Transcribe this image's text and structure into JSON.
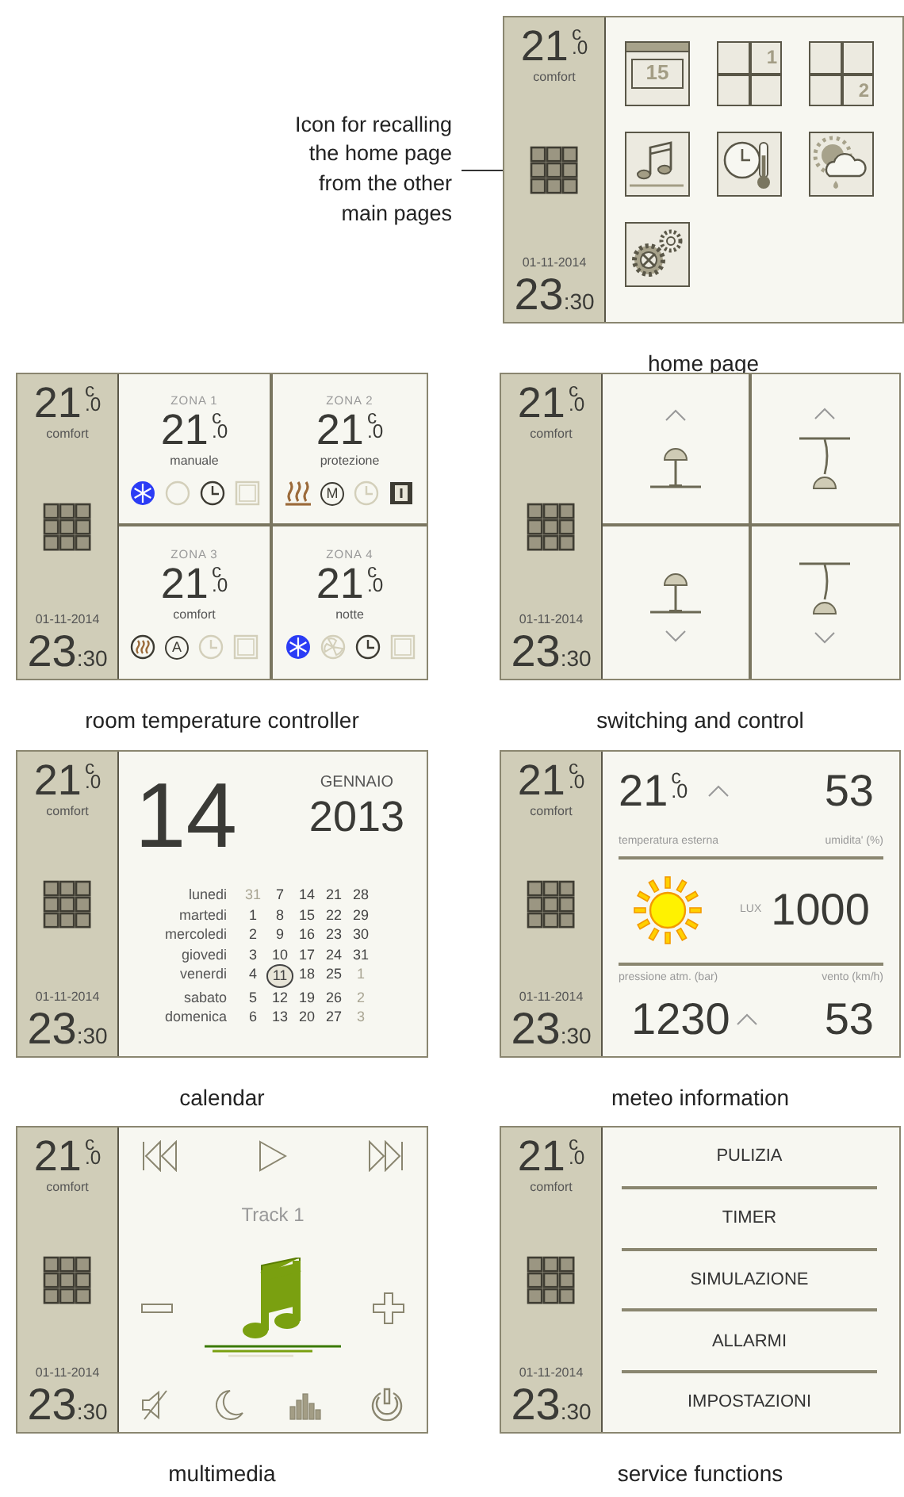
{
  "annotation": {
    "text": "Icon for recalling\nthe home page\nfrom the other\nmain pages"
  },
  "screens": [
    {
      "kind": "home",
      "caption": "home page",
      "sidebar": {
        "temp": "21",
        "decimal": ".0",
        "unit": "c",
        "mode": "comfort",
        "date": "01-11-2014",
        "hour": "23",
        "minutes": ":30"
      },
      "tiles": [
        {
          "kind": "calendar",
          "label": "15"
        },
        {
          "kind": "zones",
          "label": "1",
          "label_at_bottom": false
        },
        {
          "kind": "zones",
          "label": "2",
          "label_at_bottom": true
        },
        {
          "kind": "music"
        },
        {
          "kind": "climate"
        },
        {
          "kind": "weather"
        },
        {
          "kind": "settings"
        }
      ]
    },
    {
      "kind": "thermostat",
      "caption": "room temperature controller",
      "sidebar": {
        "temp": "21",
        "decimal": ".0",
        "unit": "c",
        "mode": "comfort",
        "date": "01-11-2014",
        "hour": "23",
        "minutes": ":30"
      },
      "zones": [
        {
          "title": "ZONA 1",
          "temp": "21",
          "decimal": ".0",
          "unit": "c",
          "mode": "manuale",
          "icons": [
            {
              "kind": "snowflake",
              "active": true
            },
            {
              "kind": "circle",
              "active": false
            },
            {
              "kind": "clock",
              "active": true
            },
            {
              "kind": "window",
              "active": false
            }
          ]
        },
        {
          "title": "ZONA 2",
          "temp": "21",
          "decimal": ".0",
          "unit": "c",
          "mode": "protezione",
          "icons": [
            {
              "kind": "heater",
              "active": true
            },
            {
              "kind": "letter",
              "label": "M",
              "active": true
            },
            {
              "kind": "clock",
              "active": false
            },
            {
              "kind": "window-alert",
              "active": true
            }
          ]
        },
        {
          "title": "ZONA 3",
          "temp": "21",
          "decimal": ".0",
          "unit": "c",
          "mode": "comfort",
          "icons": [
            {
              "kind": "heater-circle",
              "active": true
            },
            {
              "kind": "letter",
              "label": "A",
              "active": true
            },
            {
              "kind": "clock",
              "active": false
            },
            {
              "kind": "window",
              "active": false
            }
          ]
        },
        {
          "title": "ZONA 4",
          "temp": "21",
          "decimal": ".0",
          "unit": "c",
          "mode": "notte",
          "icons": [
            {
              "kind": "snowflake",
              "active": true
            },
            {
              "kind": "fan",
              "active": false
            },
            {
              "kind": "clock",
              "active": true
            },
            {
              "kind": "window",
              "active": false
            }
          ]
        }
      ]
    },
    {
      "kind": "switching",
      "caption": "switching and control",
      "sidebar": {
        "temp": "21",
        "decimal": ".0",
        "unit": "c",
        "mode": "comfort",
        "date": "01-11-2014",
        "hour": "23",
        "minutes": ":30"
      },
      "lights": [
        {
          "kind": "table-lamp",
          "arrow_up": true
        },
        {
          "kind": "pendant-lamp",
          "arrow_up": true
        },
        {
          "kind": "table-lamp",
          "arrow_up": false
        },
        {
          "kind": "pendant-lamp",
          "arrow_up": false
        }
      ]
    },
    {
      "kind": "calendar",
      "caption": "calendar",
      "sidebar": {
        "temp": "21",
        "decimal": ".0",
        "unit": "c",
        "mode": "comfort",
        "date": "01-11-2014",
        "hour": "23",
        "minutes": ":30"
      },
      "day": "14",
      "month": "GENNAIO",
      "year": "2013",
      "weeks": [
        {
          "name": "lunedi",
          "days": [
            {
              "text": "31",
              "muted": true,
              "selected": false
            },
            {
              "text": "7",
              "muted": false,
              "selected": false
            },
            {
              "text": "14",
              "muted": false,
              "selected": false
            },
            {
              "text": "21",
              "muted": false,
              "selected": false
            },
            {
              "text": "28",
              "muted": false,
              "selected": false
            }
          ]
        },
        {
          "name": "martedi",
          "days": [
            {
              "text": "1",
              "muted": false,
              "selected": false
            },
            {
              "text": "8",
              "muted": false,
              "selected": false
            },
            {
              "text": "15",
              "muted": false,
              "selected": false
            },
            {
              "text": "22",
              "muted": false,
              "selected": false
            },
            {
              "text": "29",
              "muted": false,
              "selected": false
            }
          ]
        },
        {
          "name": "mercoledi",
          "days": [
            {
              "text": "2",
              "muted": false,
              "selected": false
            },
            {
              "text": "9",
              "muted": false,
              "selected": false
            },
            {
              "text": "16",
              "muted": false,
              "selected": false
            },
            {
              "text": "23",
              "muted": false,
              "selected": false
            },
            {
              "text": "30",
              "muted": false,
              "selected": false
            }
          ]
        },
        {
          "name": "giovedi",
          "days": [
            {
              "text": "3",
              "muted": false,
              "selected": false
            },
            {
              "text": "10",
              "muted": false,
              "selected": false
            },
            {
              "text": "17",
              "muted": false,
              "selected": false
            },
            {
              "text": "24",
              "muted": false,
              "selected": false
            },
            {
              "text": "31",
              "muted": false,
              "selected": false
            }
          ]
        },
        {
          "name": "venerdi",
          "days": [
            {
              "text": "4",
              "muted": false,
              "selected": false
            },
            {
              "text": "11",
              "muted": false,
              "selected": true
            },
            {
              "text": "18",
              "muted": false,
              "selected": false
            },
            {
              "text": "25",
              "muted": false,
              "selected": false
            },
            {
              "text": "1",
              "muted": true,
              "selected": false
            }
          ]
        },
        {
          "name": "sabato",
          "days": [
            {
              "text": "5",
              "muted": false,
              "selected": false
            },
            {
              "text": "12",
              "muted": false,
              "selected": false
            },
            {
              "text": "19",
              "muted": false,
              "selected": false
            },
            {
              "text": "26",
              "muted": false,
              "selected": false
            },
            {
              "text": "2",
              "muted": true,
              "selected": false
            }
          ]
        },
        {
          "name": "domenica",
          "days": [
            {
              "text": "6",
              "muted": false,
              "selected": false
            },
            {
              "text": "13",
              "muted": false,
              "selected": false
            },
            {
              "text": "20",
              "muted": false,
              "selected": false
            },
            {
              "text": "27",
              "muted": false,
              "selected": false
            },
            {
              "text": "3",
              "muted": true,
              "selected": false
            }
          ]
        }
      ]
    },
    {
      "kind": "meteo",
      "caption": "meteo information",
      "sidebar": {
        "temp": "21",
        "decimal": ".0",
        "unit": "c",
        "mode": "comfort",
        "date": "01-11-2014",
        "hour": "23",
        "minutes": ":30"
      },
      "temperature": {
        "value": "21",
        "decimal": ".0",
        "unit": "c"
      },
      "temperature_rising": true,
      "humidity": "53",
      "temperature_label": "temperatura esterna",
      "humidity_label": "umidita' (%)",
      "lux_label": "LUX",
      "lux": "1000",
      "pressure_label": "pressione atm. (bar)",
      "wind_label": "vento (km/h)",
      "pressure": "1230",
      "pressure_rising": true,
      "wind": "53"
    },
    {
      "kind": "multimedia",
      "caption": "multimedia",
      "sidebar": {
        "temp": "21",
        "decimal": ".0",
        "unit": "c",
        "mode": "comfort",
        "date": "01-11-2014",
        "hour": "23",
        "minutes": ":30"
      },
      "track": "Track 1"
    },
    {
      "kind": "services",
      "caption": "service functions",
      "sidebar": {
        "temp": "21",
        "decimal": ".0",
        "unit": "c",
        "mode": "comfort",
        "date": "01-11-2014",
        "hour": "23",
        "minutes": ":30"
      },
      "items": [
        "PULIZIA",
        "TIMER",
        "SIMULAZIONE",
        "ALLARMI",
        "IMPOSTAZIONI"
      ]
    }
  ]
}
